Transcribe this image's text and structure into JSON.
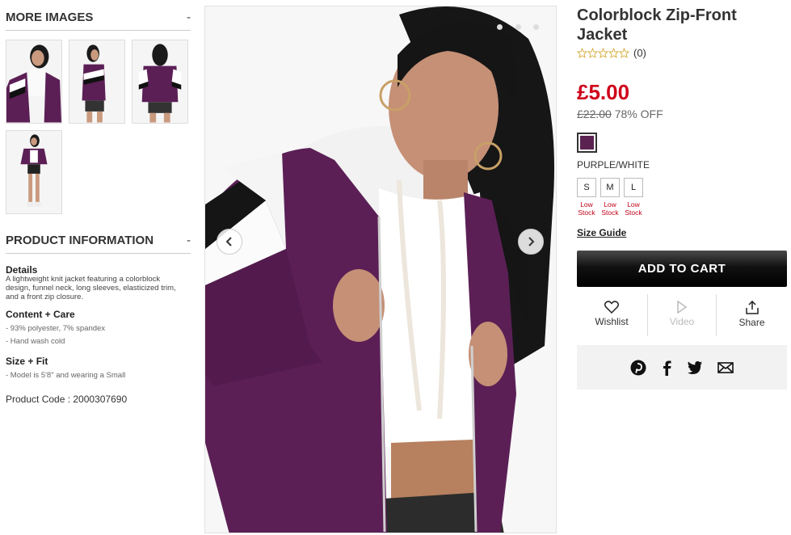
{
  "more_images": {
    "title": "MORE IMAGES",
    "toggle": "-"
  },
  "product_info": {
    "title": "PRODUCT INFORMATION",
    "toggle": "-",
    "details_label": "Details",
    "details_text_1": "A lightweight knit jacket featuring a colorblock",
    "details_text_2": "design, funnel neck, long sleeves, elasticized trim,",
    "details_text_3": "and a front zip closure.",
    "care_label": "Content + Care",
    "care_items": [
      "- 93% polyester, 7% spandex",
      "- Hand wash cold"
    ],
    "fit_label": "Size + Fit",
    "fit_items": [
      "- Model is 5'8\" and wearing a Small"
    ],
    "product_code": "Product Code : 2000307690"
  },
  "product": {
    "title_line1": "Colorblock Zip-Front",
    "title_line2": "Jacket",
    "rating_count": "(0)",
    "price": "£5.00",
    "original_price": "£22.00",
    "discount": "78% OFF",
    "color_name": "PURPLE/WHITE",
    "swatch_color": "#5b2251",
    "sizes": [
      {
        "label": "S",
        "stock_line1": "Low",
        "stock_line2": "Stock"
      },
      {
        "label": "M",
        "stock_line1": "Low",
        "stock_line2": "Stock"
      },
      {
        "label": "L",
        "stock_line1": "Low",
        "stock_line2": "Stock"
      }
    ],
    "size_guide": "Size Guide",
    "add_to_cart": "ADD TO CART"
  },
  "actions": {
    "wishlist": "Wishlist",
    "video": "Video",
    "share": "Share"
  },
  "colors": {
    "price_red": "#d0021b",
    "jacket_purple": "#5b1f55",
    "cart_bg": "#111111"
  }
}
